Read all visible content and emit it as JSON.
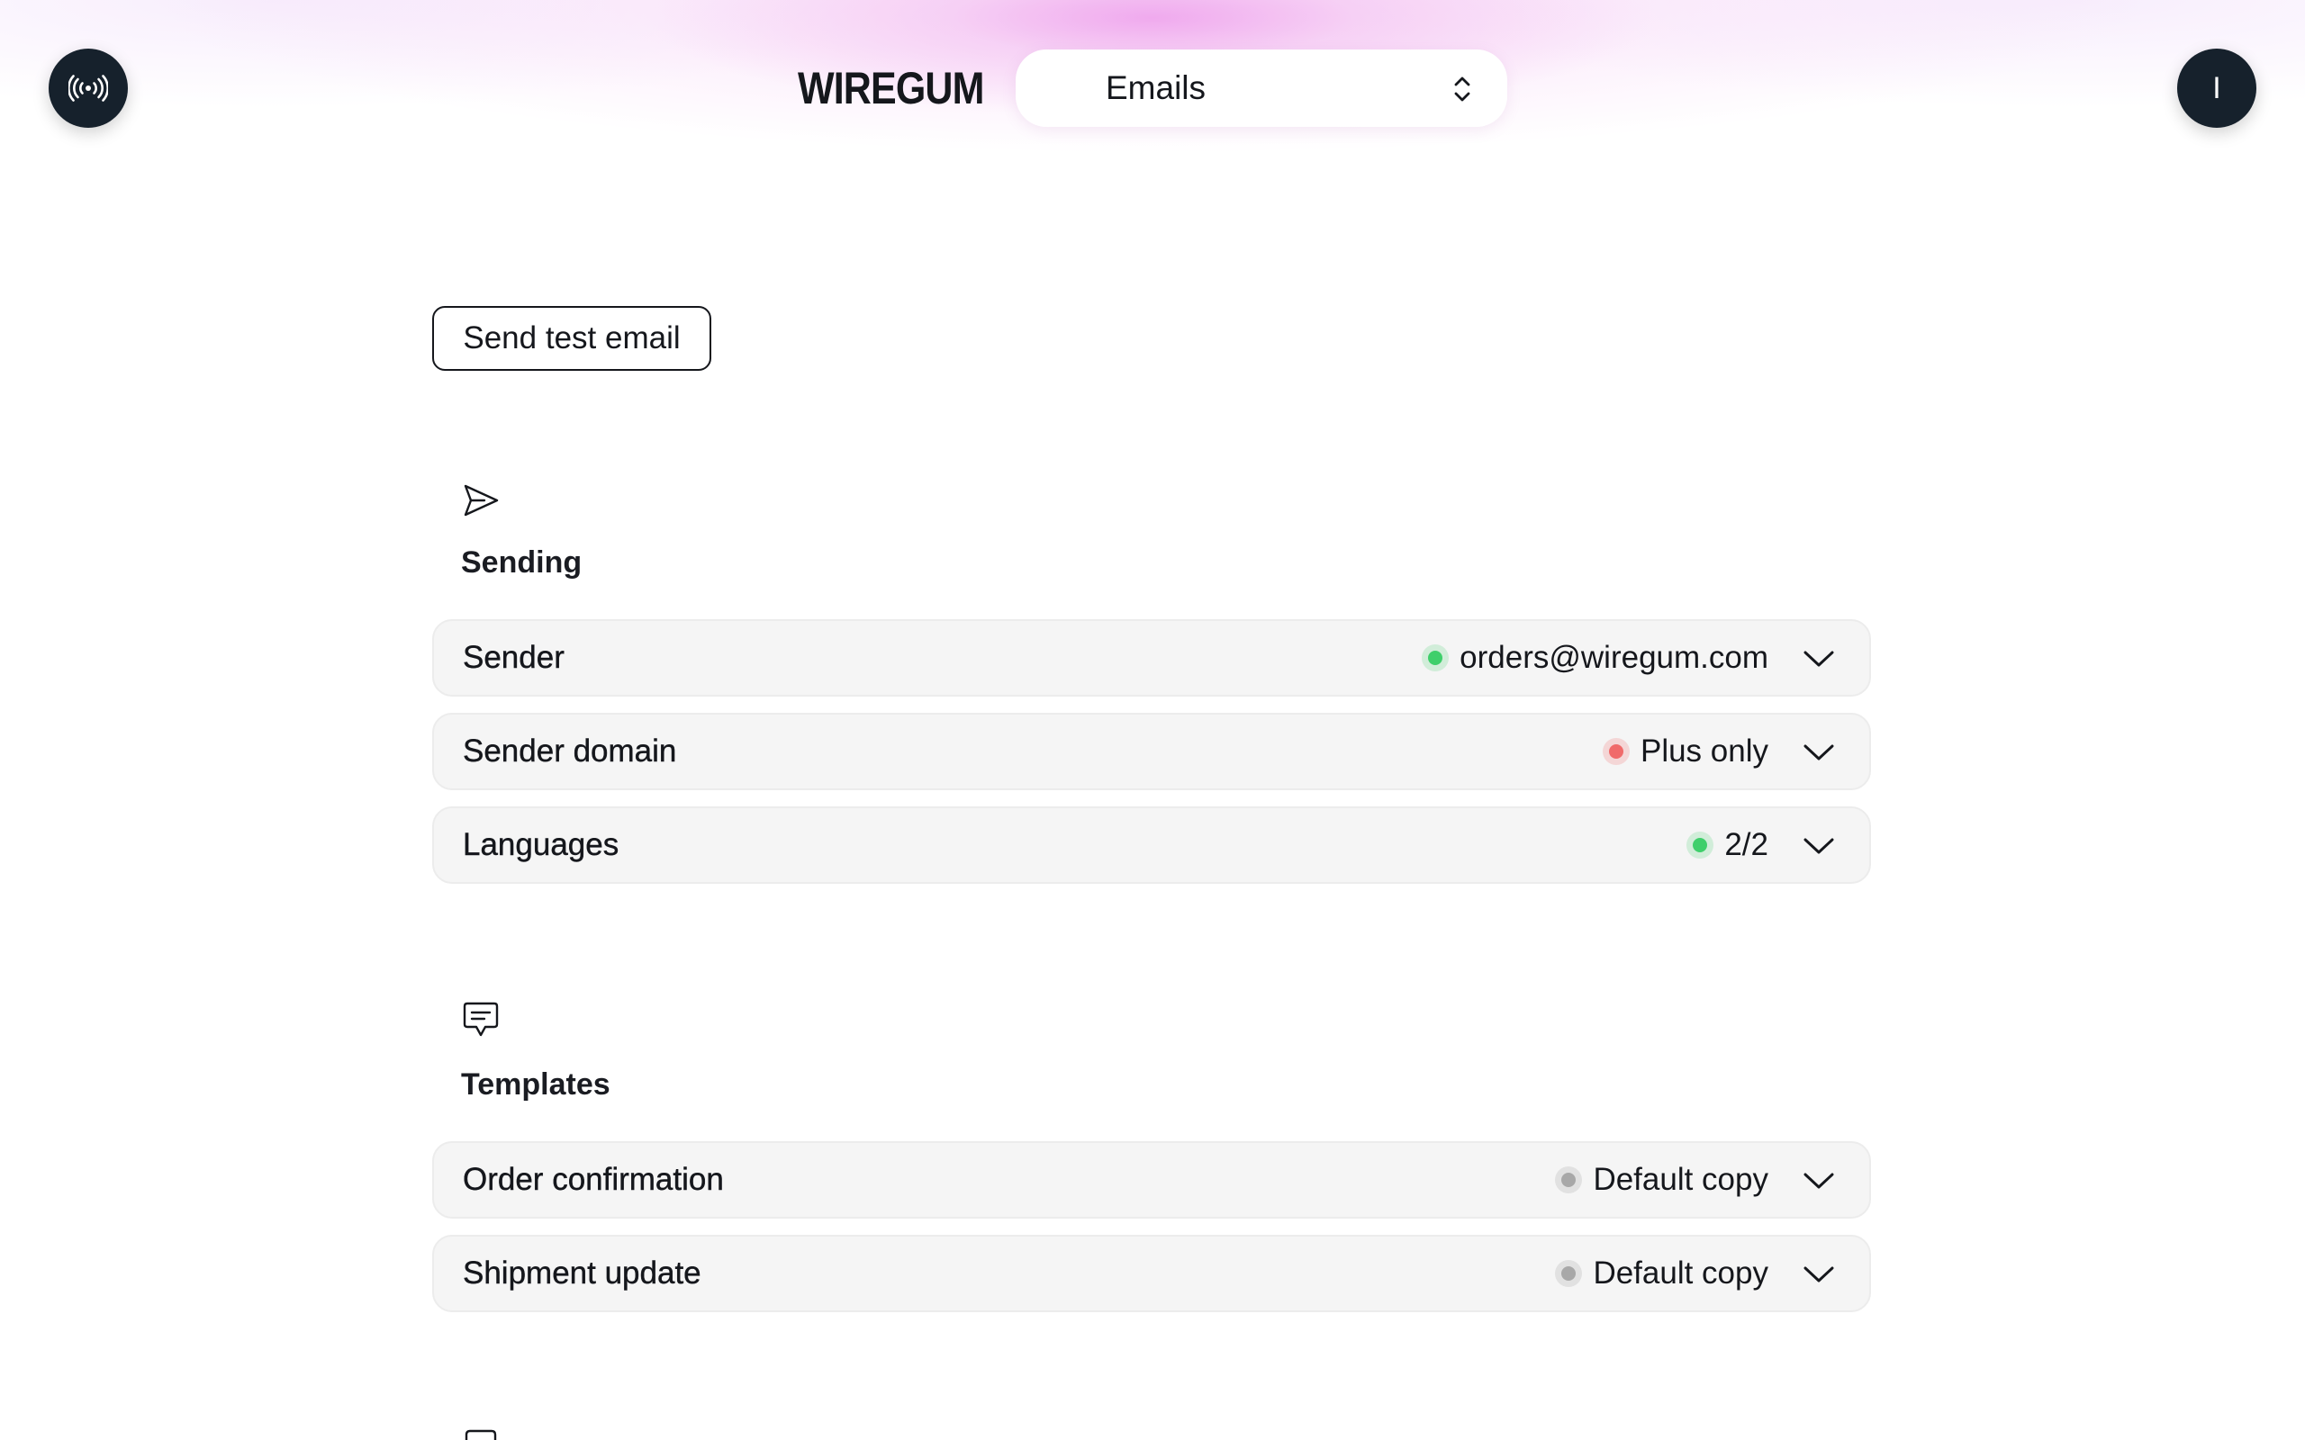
{
  "header": {
    "broadcast_icon": "broadcast-icon",
    "logo": "WIREGUM",
    "selector": {
      "label": "Emails",
      "icon": "up-down-chevron-icon"
    },
    "avatar_letter": "I"
  },
  "actions": {
    "send_test_label": "Send test email"
  },
  "colors": {
    "status_green": "#3fcf6b",
    "status_red": "#f06a6a",
    "status_gray": "#a8a8a8",
    "header_dark": "#16212c",
    "glow_pink": "#f1b8ef"
  },
  "sections": [
    {
      "icon": "paper-plane-icon",
      "title": "Sending",
      "rows": [
        {
          "label": "Sender",
          "status": "green",
          "value": "orders@wiregum.com"
        },
        {
          "label": "Sender domain",
          "status": "red",
          "value": "Plus only"
        },
        {
          "label": "Languages",
          "status": "green",
          "value": "2/2"
        }
      ]
    },
    {
      "icon": "chat-bubble-icon",
      "title": "Templates",
      "rows": [
        {
          "label": "Order confirmation",
          "status": "gray",
          "value": "Default copy"
        },
        {
          "label": "Shipment update",
          "status": "gray",
          "value": "Default copy"
        }
      ]
    }
  ]
}
